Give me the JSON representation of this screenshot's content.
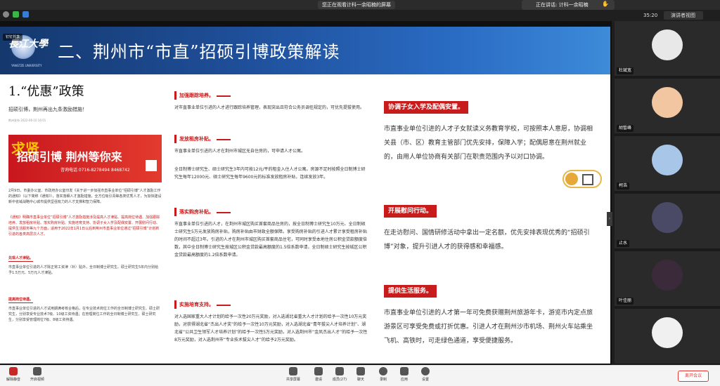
{
  "topbar": {
    "notice": "您正在观看计科一余昭楠的屏幕",
    "speaking": "正在讲话: 计科一余昭楠"
  },
  "statusbar": {
    "time": "35:20",
    "view_label": "演讲者视图"
  },
  "slide": {
    "univ_cn": "長江大學",
    "univ_en": "YANGTZE UNIVERSITY",
    "title": "二、荆州市“市直”招硕引博政策解读",
    "screenshare_tag": "钉钉共享",
    "col1": {
      "heading": "1.“优惠”政策",
      "sub": "招硕引博，荆州再出九条激励措施！",
      "meta": "荆州发布  2022-06-10 16:01",
      "banner_pre": "求贤",
      "banner_text": "招硕引博 荆州等你来",
      "banner_phone": "咨询电话 0716-8278494 8468742",
      "para1": "2月9日，市委办公室、市政府办公室印发《关于进一步加强市直事业单位“招硕引博”人才激励工作的通知》（以下简称《通知》），落实落细人才激励措施，全方位吸引青睐各类优秀人才，为加快建设新中省域战略中心城市提供坚强有力的人才支撑和智力保障。",
      "para2": "《通知》明确市直事业单位“招硕引博”人才激励措施涉及提高人才津贴、提高岗位待遇、加强跟踪培养、发放租房补贴、落实购房补贴、实施培育支持、协调子女入学及配偶安置、开展慰问行动、提供生活服务等九个方面，适用于2022年1月1日以后到荆州市直事业单位通过“招硕引博”计划新引进的各类高层次人才。",
      "sub1": "兑现人才津贴。",
      "para3": "市直事业单位引进的人才除正常工资津（补）贴外，全日制博士研究生、硕士研究生5年内分别给予1.5万元、5万元人才津贴。",
      "sub2": "提高岗位待遇。",
      "para4": "市直事业单位引进的人才试用期满考核合格后，在专业技术岗位工作的全日制博士研究生、硕士研究生，分别享受专业技术7级、10级工资待遇；在管理岗位工作的全日制博士研究生、硕士研究生，分别享受管理岗位7级、8级工资待遇。"
    },
    "col2": {
      "s1_title": "加强跟踪培养。",
      "s1_body": "对市直事业单位引进的人才进行跟踪培养管理，表现突出且符合公务员调任规定的，可优先提拔使用。",
      "s2_title": "发放租房补贴。",
      "s2_body": "市直事业单位引进的人才在荆州市城区无自住房的，可申请人才公寓。",
      "s2_body2": "全日制博士研究生、硕士研究生3年内可按12元/平的租金入住人才公寓。房源不足时按照全日制博士研究生每年12000元、硕士研究生每年9600元的标准发放租房补贴，连续发放3年。",
      "s3_title": "落实购房补贴。",
      "s3_body": "市直事业单位引进的人才，在荆州市城区购买首套商品住房的，按全日制博士研究生10万元、全日制硕士研究生5万元发放购房补贴，购房补贴由市财政全额保障。享受购房补贴的引进人才累计享受租房补贴的时间不超过3年。引进的人才在荆州市城区购买首套商品住宅，可同时享受本地住房公积金贷款额度倍数，其中全日制博士研究生按城区公积金贷款最高额度的1.5倍系数申请，全日制硕士研究生按城区公积金贷款最高额度的1.2倍系数申请。",
      "s4_title": "实施培育支持。",
      "s4_body": "对入选国家重大人才计划的给予一次性20万元奖励，对入选湖北省重大人才计划的给予一次性10万元奖励，对获得湖北省“杰出人才奖”的给予一次性10万元奖励，对入选湖北省“青年拔尖人才培养计划”、湖北省“公共卫生领军人才培养计划”的给予一次性5万元奖励，对入选荆州市“金凤杰出人才”的给予一次性8万元奖励，对入选荆州市“专业技术拔尖人才”的给予2万元奖励。"
    },
    "col3": {
      "s1_title": "协调子女入学及配偶安置。",
      "s1_body": "市直事业单位引进的人才子女就读义务教育学校，可按照本人意愿，协调相关县（市、区）教育主管部门优先安排，保障入学；配偶愿意在荆州就业的，由用人单位协商有关部门在职责范围内予以对口协调。",
      "s2_title": "开展慰问行动。",
      "s2_body": "在走访慰问、国情研修活动中拿出一定名额，优先安排表现优秀的“招硕引博”对象，提升引进人才的获得感和幸福感。",
      "s3_title": "提供生活服务。",
      "s3_body": "市直事业单位引进的人才第一年可免费获赠荆州旅游年卡，游览市内定点旅游景区可享受免费或打折优惠。引进人才在荆州沙市机场、荆州火车站乘坐飞机、高铁时，可走绿色通道，享受便捷服务。"
    }
  },
  "participants": [
    {
      "name": "杜斌宽",
      "color": "#e8e8e8"
    },
    {
      "name": "胡皙峰",
      "color": "#f1c6a0"
    },
    {
      "name": "柯浩",
      "color": "#a8c7e8"
    },
    {
      "name": "止水",
      "color": "#4a4a66"
    },
    {
      "name": "叶佳丽",
      "color": "#3a2a3a"
    },
    {
      "name": "",
      "color": "#f0f0f0"
    }
  ],
  "toolbar": {
    "mute": "解除静音",
    "video": "开启视频",
    "share": "共享屏幕",
    "invite": "邀请",
    "members": "成员(27)",
    "chat": "聊天",
    "record": "录制",
    "apps": "应用",
    "settings": "设置",
    "leave": "离开会议"
  }
}
